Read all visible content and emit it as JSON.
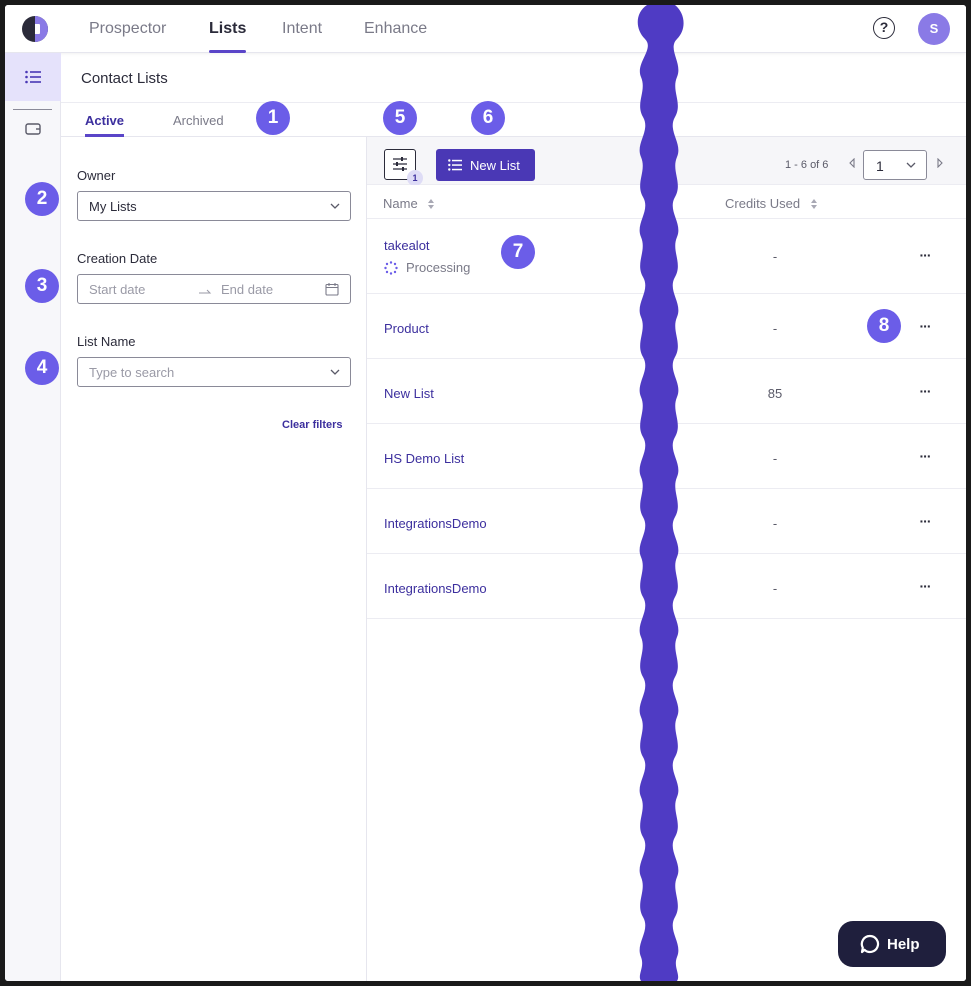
{
  "nav": {
    "tabs": [
      {
        "label": "Prospector"
      },
      {
        "label": "Lists"
      },
      {
        "label": "Intent"
      },
      {
        "label": "Enhance"
      }
    ],
    "help_icon_text": "?",
    "avatar_initial": "S"
  },
  "page": {
    "title": "Contact Lists",
    "subtabs": [
      {
        "label": "Active"
      },
      {
        "label": "Archived"
      }
    ]
  },
  "filters": {
    "owner_label": "Owner",
    "owner_value": "My Lists",
    "creation_date_label": "Creation Date",
    "start_placeholder": "Start date",
    "end_placeholder": "End date",
    "list_name_label": "List Name",
    "list_name_placeholder": "Type to search",
    "clear_label": "Clear filters"
  },
  "toolbar": {
    "filter_badge": "1",
    "new_list_label": "New List",
    "page_info": "1 - 6 of 6",
    "page_value": "1"
  },
  "table": {
    "columns": [
      {
        "label": "Name"
      },
      {
        "label": "Credits Used"
      }
    ],
    "rows": [
      {
        "name": "takealot",
        "status": "Processing",
        "credits": "-",
        "more": "···"
      },
      {
        "name": "Product",
        "credits": "-",
        "more": "···"
      },
      {
        "name": "New List",
        "credits": "85",
        "more": "···"
      },
      {
        "name": "HS Demo List",
        "credits": "-",
        "more": "···"
      },
      {
        "name": "IntegrationsDemo",
        "credits": "-",
        "more": "···"
      },
      {
        "name": "IntegrationsDemo",
        "credits": "-",
        "more": "···"
      }
    ]
  },
  "markers": [
    "1",
    "2",
    "3",
    "4",
    "5",
    "6",
    "7",
    "8"
  ],
  "help_button": {
    "label": "Help"
  },
  "colors": {
    "accent": "#4a38b5",
    "marker": "#6b5de8",
    "link": "#3c2f9e",
    "divider_wave": "#4f3bc4",
    "help_bg": "#1f1f3d"
  }
}
